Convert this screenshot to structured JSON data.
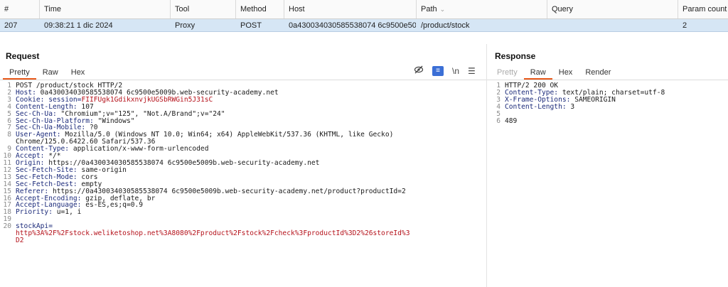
{
  "table": {
    "headers": [
      "#",
      "Time",
      "Tool",
      "Method",
      "Host",
      "Path",
      "Query",
      "Param count"
    ],
    "row": [
      "207",
      "09:38:21 1 dic 2024",
      "Proxy",
      "POST",
      "0a430034030585538074 6c9500e50…",
      "/product/stock",
      "",
      "2"
    ]
  },
  "request": {
    "title": "Request",
    "tabs": [
      "Pretty",
      "Raw",
      "Hex"
    ],
    "active_tab": "Pretty",
    "icons": [
      "eye-slash-icon",
      "wrap-icon",
      "newline-icon",
      "menu-icon"
    ],
    "newline_label": "\\n",
    "lines": [
      [
        {
          "t": "POST /product/stock HTTP/2",
          "c": "txt"
        }
      ],
      [
        {
          "t": "Host: ",
          "c": "k"
        },
        {
          "t": "0a430034030585538074 6c9500e5009b.web-security-academy.net",
          "c": "txt"
        }
      ],
      [
        {
          "t": "Cookie: ",
          "c": "k"
        },
        {
          "t": "session=",
          "c": "k"
        },
        {
          "t": "FIIFUgk1GdikxnvjkUGSbRWGin5J31sC",
          "c": "red"
        }
      ],
      [
        {
          "t": "Content-Length: ",
          "c": "k"
        },
        {
          "t": "107",
          "c": "txt"
        }
      ],
      [
        {
          "t": "Sec-Ch-Ua: ",
          "c": "k"
        },
        {
          "t": "\"Chromium\";v=\"125\", \"Not.A/Brand\";v=\"24\"",
          "c": "txt"
        }
      ],
      [
        {
          "t": "Sec-Ch-Ua-Platform: ",
          "c": "k"
        },
        {
          "t": "\"Windows\"",
          "c": "txt"
        }
      ],
      [
        {
          "t": "Sec-Ch-Ua-Mobile: ",
          "c": "k"
        },
        {
          "t": "?0",
          "c": "txt"
        }
      ],
      [
        {
          "t": "User-Agent: ",
          "c": "k"
        },
        {
          "t": "Mozilla/5.0 (Windows NT 10.0; Win64; x64) AppleWebKit/537.36 (KHTML, like Gecko)",
          "c": "txt"
        }
      ],
      [
        {
          "t": "Chrome/125.0.6422.60 Safari/537.36",
          "c": "txt"
        }
      ],
      [
        {
          "t": "Content-Type: ",
          "c": "k"
        },
        {
          "t": "application/x-www-form-urlencoded",
          "c": "txt"
        }
      ],
      [
        {
          "t": "Accept: ",
          "c": "k"
        },
        {
          "t": "*/*",
          "c": "txt"
        }
      ],
      [
        {
          "t": "Origin: ",
          "c": "k"
        },
        {
          "t": "https://0a430034030585538074 6c9500e5009b.web-security-academy.net",
          "c": "txt"
        }
      ],
      [
        {
          "t": "Sec-Fetch-Site: ",
          "c": "k"
        },
        {
          "t": "same-origin",
          "c": "txt"
        }
      ],
      [
        {
          "t": "Sec-Fetch-Mode: ",
          "c": "k"
        },
        {
          "t": "cors",
          "c": "txt"
        }
      ],
      [
        {
          "t": "Sec-Fetch-Dest: ",
          "c": "k"
        },
        {
          "t": "empty",
          "c": "txt"
        }
      ],
      [
        {
          "t": "Referer: ",
          "c": "k"
        },
        {
          "t": "https://0a430034030585538074 6c9500e5009b.web-security-academy.net/product?productId=2",
          "c": "txt"
        }
      ],
      [
        {
          "t": "Accept-Encoding: ",
          "c": "k"
        },
        {
          "t": "gzip, deflate, br",
          "c": "txt"
        }
      ],
      [
        {
          "t": "Accept-Language: ",
          "c": "k"
        },
        {
          "t": "es-ES,es;q=0.9",
          "c": "txt"
        }
      ],
      [
        {
          "t": "Priority: ",
          "c": "k"
        },
        {
          "t": "u=1, i",
          "c": "txt"
        }
      ],
      [
        {
          "t": "",
          "c": "txt"
        }
      ],
      [
        {
          "t": "stockApi=",
          "c": "k"
        }
      ],
      [
        {
          "t": "http%3A%2F%2Fstock.weliketoshop.net%3A8080%2Fproduct%2Fstock%2Fcheck%3FproductId%3D2%26storeId%3",
          "c": "red"
        }
      ],
      [
        {
          "t": "D2",
          "c": "red"
        }
      ]
    ],
    "line_numbers": [
      "1",
      "2",
      "3",
      "4",
      "5",
      "6",
      "7",
      "8",
      "",
      "9",
      "10",
      "11",
      "12",
      "13",
      "14",
      "15",
      "16",
      "17",
      "18",
      "19",
      "20",
      "",
      ""
    ]
  },
  "response": {
    "title": "Response",
    "tabs": [
      "Pretty",
      "Raw",
      "Hex",
      "Render"
    ],
    "active_tab": "Raw",
    "lines": [
      [
        {
          "t": "HTTP/2 200 OK",
          "c": "txt"
        }
      ],
      [
        {
          "t": "Content-Type: ",
          "c": "k"
        },
        {
          "t": "text/plain; charset=utf-8",
          "c": "txt"
        }
      ],
      [
        {
          "t": "X-Frame-Options: ",
          "c": "k"
        },
        {
          "t": "SAMEORIGIN",
          "c": "txt"
        }
      ],
      [
        {
          "t": "Content-Length: ",
          "c": "k"
        },
        {
          "t": "3",
          "c": "txt"
        }
      ],
      [
        {
          "t": "",
          "c": "txt"
        }
      ],
      [
        {
          "t": "489",
          "c": "txt"
        }
      ]
    ],
    "line_numbers": [
      "1",
      "2",
      "3",
      "4",
      "5",
      "6"
    ]
  },
  "colors": {
    "accent": "#e8591a",
    "selected_row": "#d6e6f5",
    "key": "#1b2a7a",
    "value_red": "#b5121b"
  }
}
